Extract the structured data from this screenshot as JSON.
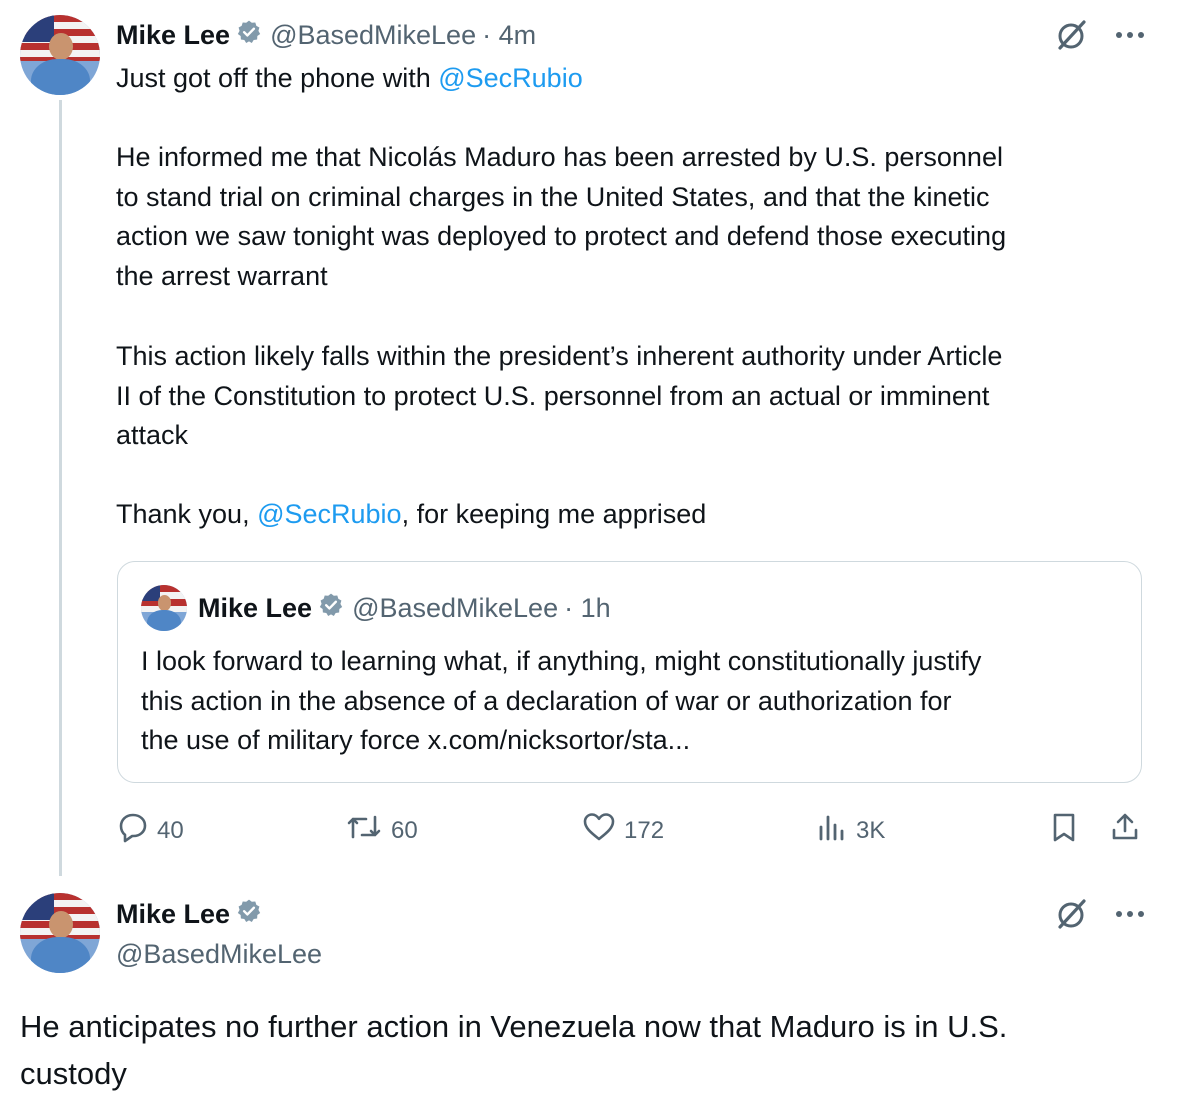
{
  "main_tweet": {
    "author": {
      "name": "Mike Lee",
      "handle": "@BasedMikeLee",
      "time": "· 4m"
    },
    "text_intro": "Just got off the phone with ",
    "mention_1": "@SecRubio",
    "paragraph_1": "He informed me that Nicolás Maduro has been arrested by U.S. personnel\nto stand trial on criminal charges in the United States, and that the kinetic\naction we saw tonight was deployed to protect and defend those executing\nthe arrest warrant",
    "paragraph_2": "This action likely falls within the president’s inherent authority under Article\nII of the Constitution to protect U.S. personnel from an actual or imminent\nattack",
    "thanks_prefix": "Thank you, ",
    "mention_2": "@SecRubio",
    "thanks_suffix": ", for keeping me apprised",
    "quote": {
      "name": "Mike Lee",
      "handle": "@BasedMikeLee",
      "time": "· 1h",
      "text": "I look forward to learning what, if anything, might constitutionally justify\nthis action in the absence of a declaration of war or authorization for\nthe use of military force x.com/nicksortor/sta..."
    },
    "stats": {
      "replies": "40",
      "reposts": "60",
      "likes": "172",
      "views": "3K"
    }
  },
  "reply_tweet": {
    "author": {
      "name": "Mike Lee",
      "handle": "@BasedMikeLee"
    },
    "text": "He anticipates no further action in Venezuela now that Maduro is in U.S.\ncustody"
  },
  "icons": {
    "more": "more-icon",
    "grok": "grok-icon",
    "verified": "verified-badge-icon",
    "reply": "reply-icon",
    "repost": "repost-icon",
    "like": "heart-icon",
    "views": "views-icon",
    "bookmark": "bookmark-icon",
    "share": "share-icon"
  },
  "colors": {
    "text": "#0f1419",
    "secondary": "#536471",
    "link": "#1d9bf0",
    "border": "#cfd9de"
  }
}
